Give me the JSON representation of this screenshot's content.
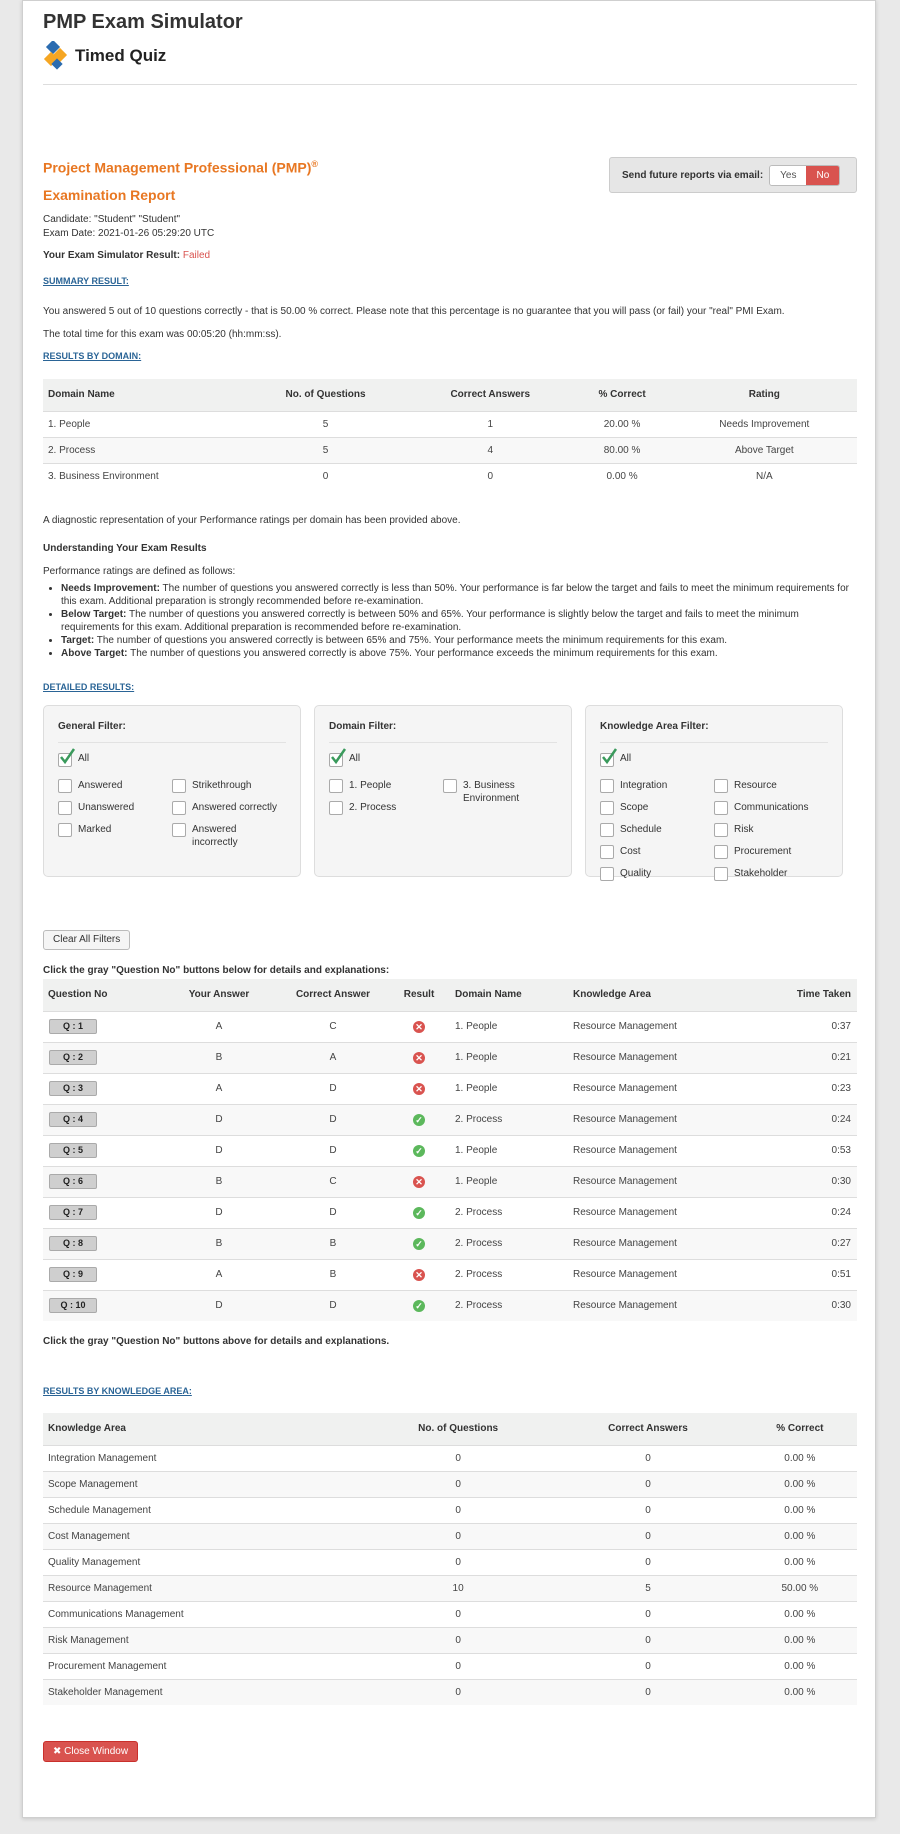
{
  "header": {
    "app_title": "PMP Exam Simulator",
    "subtitle": "Timed Quiz",
    "logo_icon": "diamond-logo-icon"
  },
  "report": {
    "title_line1": "Project Management Professional (PMP)",
    "title_mark": "®",
    "title_line2": "Examination Report",
    "candidate": "Candidate:  \"Student\"  \"Student\"",
    "exam_date": "Exam Date: 2021-01-26 05:29:20 UTC",
    "result_label": "Your Exam Simulator Result:",
    "result_value": "Failed"
  },
  "email": {
    "label": "Send future reports via email:",
    "yes": "Yes",
    "no": "No",
    "selected": "No"
  },
  "summary": {
    "link": "SUMMARY RESULT:",
    "text": "You answered 5 out of 10 questions correctly - that is 50.00 % correct. Please note that this percentage is no guarantee that you will pass (or fail) your \"real\" PMI Exam.",
    "time": "The total time for this exam was 00:05:20 (hh:mm:ss)."
  },
  "domain_results": {
    "link": "RESULTS BY DOMAIN:",
    "headers": [
      "Domain Name",
      "No. of Questions",
      "Correct Answers",
      "% Correct",
      "Rating"
    ],
    "rows": [
      [
        "1. People",
        "5",
        "1",
        "20.00 %",
        "Needs Improvement"
      ],
      [
        "2. Process",
        "5",
        "4",
        "80.00 %",
        "Above Target"
      ],
      [
        "3. Business Environment",
        "0",
        "0",
        "0.00 %",
        "N/A"
      ]
    ]
  },
  "understanding": {
    "diagnostic": "A diagnostic representation of your Performance ratings per domain has been provided above.",
    "heading": "Understanding Your Exam Results",
    "intro": "Performance ratings are defined as follows:",
    "items": [
      {
        "term": "Needs Improvement:",
        "text": "The number of questions you answered correctly is less than 50%. Your performance is far below the target and fails to meet the minimum requirements for this exam. Additional preparation is strongly recommended before re-examination."
      },
      {
        "term": "Below Target:",
        "text": "The number of questions you answered correctly is between 50% and 65%. Your performance is slightly below the target and fails to meet the minimum requirements for this exam. Additional preparation is recommended before re-examination."
      },
      {
        "term": "Target:",
        "text": "The number of questions you answered correctly is between 65% and 75%. Your performance meets the minimum requirements for this exam."
      },
      {
        "term": "Above Target:",
        "text": "The number of questions you answered correctly is above 75%. Your performance exceeds the minimum requirements for this exam."
      }
    ]
  },
  "detailed": {
    "link": "DETAILED RESULTS:",
    "general_filter": {
      "title": "General Filter:",
      "all": "All",
      "options": [
        "Answered",
        "Strikethrough",
        "Unanswered",
        "Answered correctly",
        "Marked",
        "Answered incorrectly"
      ]
    },
    "domain_filter": {
      "title": "Domain Filter:",
      "all": "All",
      "options": [
        "1. People",
        "3. Business Environment",
        "2. Process"
      ]
    },
    "knowledge_filter": {
      "title": "Knowledge Area Filter:",
      "all": "All",
      "options": [
        "Integration",
        "Resource",
        "Scope",
        "Communications",
        "Schedule",
        "Risk",
        "Cost",
        "Procurement",
        "Quality",
        "Stakeholder"
      ]
    },
    "clear_button": "Clear All Filters",
    "hint_top": "Click the gray \"Question No\" buttons below for details and explanations:",
    "hint_bottom": "Click the gray \"Question No\" buttons above for details and explanations.",
    "headers": [
      "Question No",
      "Your Answer",
      "Correct Answer",
      "Result",
      "Domain Name",
      "Knowledge Area",
      "Time Taken"
    ],
    "rows": [
      {
        "q": "Q : 1",
        "your": "A",
        "correct": "C",
        "result": "wrong",
        "domain": "1. People",
        "ka": "Resource Management",
        "time": "0:37"
      },
      {
        "q": "Q : 2",
        "your": "B",
        "correct": "A",
        "result": "wrong",
        "domain": "1. People",
        "ka": "Resource Management",
        "time": "0:21"
      },
      {
        "q": "Q : 3",
        "your": "A",
        "correct": "D",
        "result": "wrong",
        "domain": "1. People",
        "ka": "Resource Management",
        "time": "0:23"
      },
      {
        "q": "Q : 4",
        "your": "D",
        "correct": "D",
        "result": "correct",
        "domain": "2. Process",
        "ka": "Resource Management",
        "time": "0:24"
      },
      {
        "q": "Q : 5",
        "your": "D",
        "correct": "D",
        "result": "correct",
        "domain": "1. People",
        "ka": "Resource Management",
        "time": "0:53"
      },
      {
        "q": "Q : 6",
        "your": "B",
        "correct": "C",
        "result": "wrong",
        "domain": "1. People",
        "ka": "Resource Management",
        "time": "0:30"
      },
      {
        "q": "Q : 7",
        "your": "D",
        "correct": "D",
        "result": "correct",
        "domain": "2. Process",
        "ka": "Resource Management",
        "time": "0:24"
      },
      {
        "q": "Q : 8",
        "your": "B",
        "correct": "B",
        "result": "correct",
        "domain": "2. Process",
        "ka": "Resource Management",
        "time": "0:27"
      },
      {
        "q": "Q : 9",
        "your": "A",
        "correct": "B",
        "result": "wrong",
        "domain": "2. Process",
        "ka": "Resource Management",
        "time": "0:51"
      },
      {
        "q": "Q : 10",
        "your": "D",
        "correct": "D",
        "result": "correct",
        "domain": "2. Process",
        "ka": "Resource Management",
        "time": "0:30"
      }
    ]
  },
  "knowledge_results": {
    "link": "RESULTS BY KNOWLEDGE AREA:",
    "headers": [
      "Knowledge Area",
      "No. of Questions",
      "Correct Answers",
      "% Correct"
    ],
    "rows": [
      [
        "Integration Management",
        "0",
        "0",
        "0.00 %"
      ],
      [
        "Scope Management",
        "0",
        "0",
        "0.00 %"
      ],
      [
        "Schedule Management",
        "0",
        "0",
        "0.00 %"
      ],
      [
        "Cost Management",
        "0",
        "0",
        "0.00 %"
      ],
      [
        "Quality Management",
        "0",
        "0",
        "0.00 %"
      ],
      [
        "Resource Management",
        "10",
        "5",
        "50.00 %"
      ],
      [
        "Communications Management",
        "0",
        "0",
        "0.00 %"
      ],
      [
        "Risk Management",
        "0",
        "0",
        "0.00 %"
      ],
      [
        "Procurement Management",
        "0",
        "0",
        "0.00 %"
      ],
      [
        "Stakeholder Management",
        "0",
        "0",
        "0.00 %"
      ]
    ]
  },
  "close_button": "Close Window",
  "colors": {
    "accent_orange": "#e87722",
    "fail_red": "#d9534f",
    "pass_green": "#5cb85c",
    "link_blue": "#2a6496"
  }
}
